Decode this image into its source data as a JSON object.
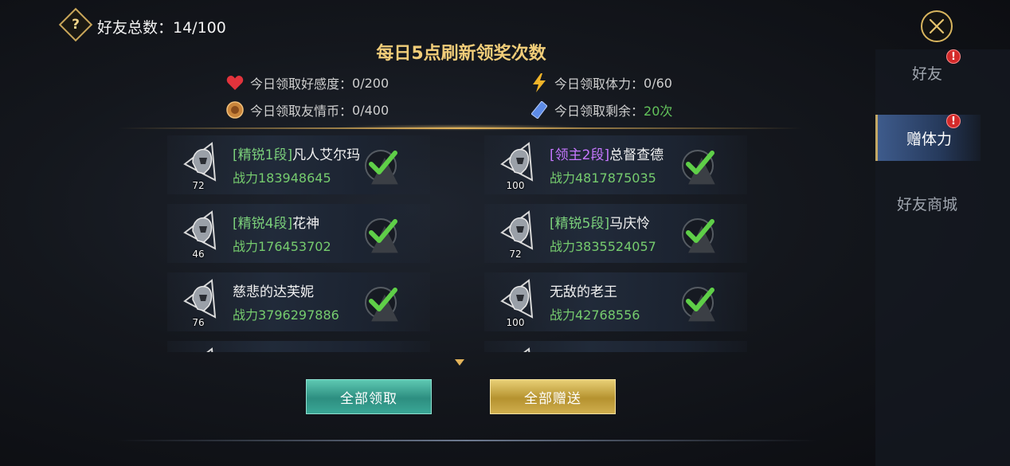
{
  "header": {
    "help_icon": "question-icon",
    "friend_total_label": "好友总数：14/100",
    "close_icon": "close-icon"
  },
  "refresh_title": "每日5点刷新领奖次数",
  "stats": {
    "favor": {
      "icon": "heart-icon",
      "label": "今日领取好感度：",
      "value": "0/200"
    },
    "stamina": {
      "icon": "lightning-icon",
      "label": "今日领取体力：",
      "value": "0/60"
    },
    "coins": {
      "icon": "coin-icon",
      "label": "今日领取友情币：",
      "value": "0/400"
    },
    "remaining": {
      "icon": "crystal-icon",
      "label": "今日领取剩余：",
      "value": "20次"
    }
  },
  "friends": [
    {
      "rank": "[精锐1段]",
      "rank_color": "green",
      "name": "凡人艾尔玛",
      "power": "战力183948645",
      "level": "72"
    },
    {
      "rank": "[领主2段]",
      "rank_color": "purple",
      "name": "总督查德",
      "power": "战力4817875035",
      "level": "100"
    },
    {
      "rank": "[精锐4段]",
      "rank_color": "green",
      "name": "花神",
      "power": "战力176453702",
      "level": "46"
    },
    {
      "rank": "[精锐5段]",
      "rank_color": "green",
      "name": "马庆怜",
      "power": "战力3835524057",
      "level": "72"
    },
    {
      "rank": "",
      "rank_color": "",
      "name": "慈悲的达芙妮",
      "power": "战力3796297886",
      "level": "76"
    },
    {
      "rank": "",
      "rank_color": "",
      "name": "无敌的老王",
      "power": "战力42768556",
      "level": "100"
    }
  ],
  "buttons": {
    "claim_all": "全部领取",
    "gift_all": "全部赠送"
  },
  "sidebar": {
    "tabs": [
      {
        "label": "好友",
        "badge": "!"
      },
      {
        "label": "赠体力",
        "badge": "!"
      },
      {
        "label": "好友商城",
        "badge": ""
      }
    ]
  },
  "colors": {
    "gold": "#f1cd79",
    "green": "#76cc6e",
    "purple": "#c677ff",
    "teal_button": "#3aa796",
    "gold_button": "#cfae4e",
    "badge_red": "#d42a2a"
  }
}
